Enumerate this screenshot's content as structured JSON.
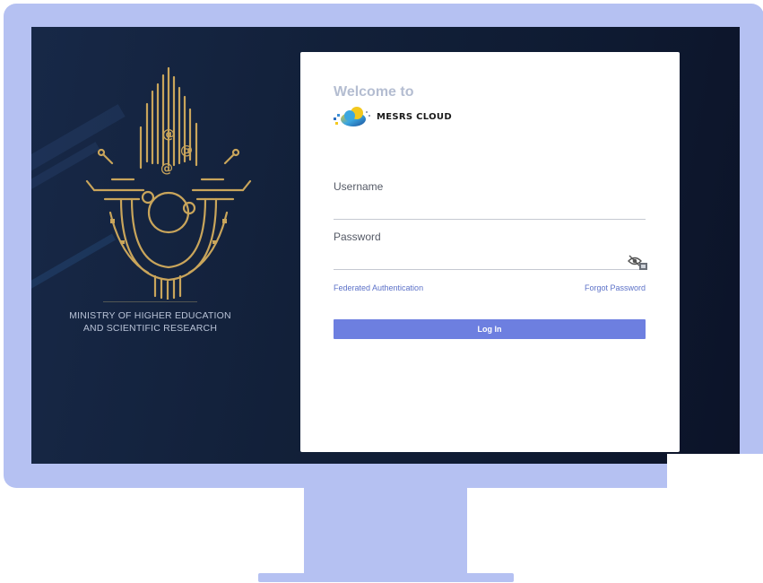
{
  "login": {
    "welcome": "Welcome to",
    "brand": "MESRS CLOUD",
    "username_label": "Username",
    "username_value": "",
    "password_label": "Password",
    "password_value": "",
    "federated_link": "Federated Authentication",
    "forgot_link": "Forgot Password",
    "login_button": "Log In"
  },
  "ministry": {
    "line1": "MINISTRY OF HIGHER EDUCATION",
    "line2": "AND SCIENTIFIC RESEARCH"
  },
  "icons": {
    "emblem": "ministry-emblem-icon",
    "logo": "mesrs-cloud-logo-icon",
    "password_toggle": "eye-slash-icon"
  },
  "colors": {
    "monitor_frame": "#b5c1f2",
    "screen_background": "#122039",
    "emblem_gold": "#c9a55b",
    "welcome_text": "#b4bdd1",
    "link": "#5d72c8",
    "button": "#6d7fe0",
    "card": "#ffffff"
  }
}
